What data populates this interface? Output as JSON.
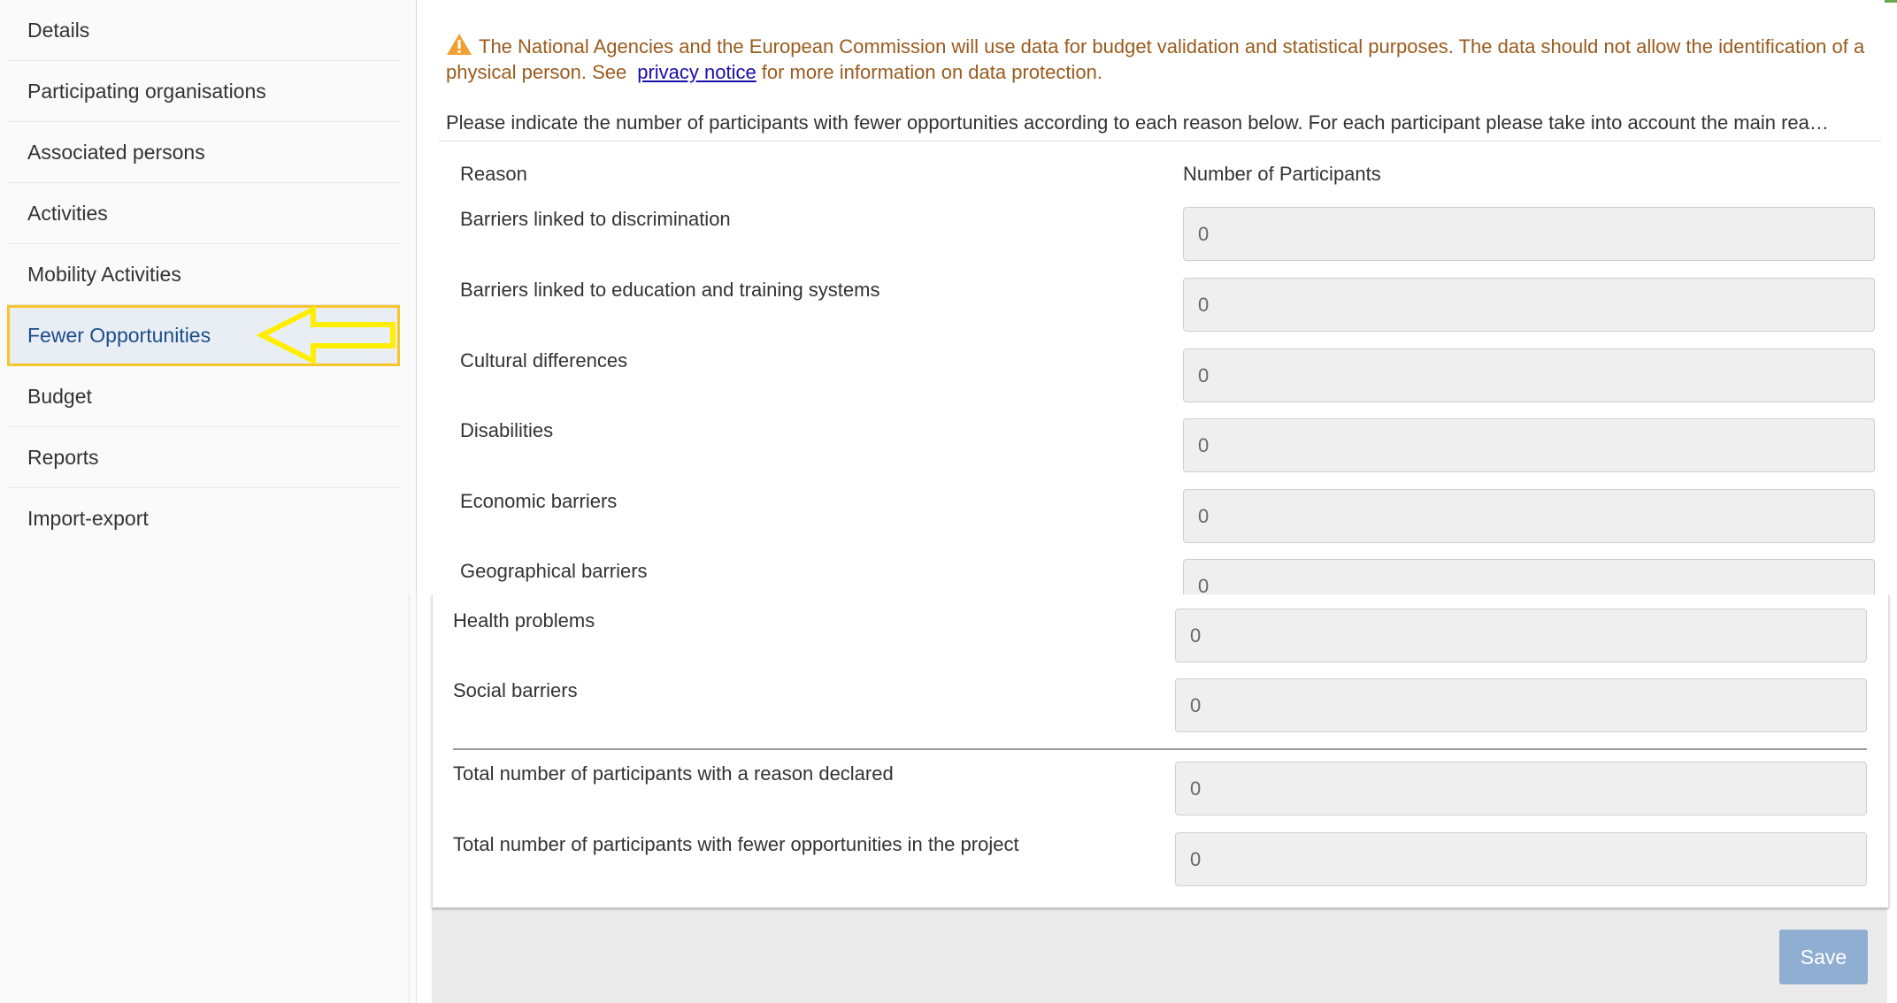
{
  "sidebar": {
    "items": [
      {
        "label": "Details"
      },
      {
        "label": "Participating organisations"
      },
      {
        "label": "Associated persons"
      },
      {
        "label": "Activities"
      },
      {
        "label": "Mobility Activities"
      },
      {
        "label": "Fewer Opportunities",
        "active": true
      },
      {
        "label": "Budget"
      },
      {
        "label": "Reports"
      },
      {
        "label": "Import-export"
      }
    ]
  },
  "notice": {
    "text_before": "The National Agencies and the European Commission will use data for budget validation and statistical purposes. The data should not allow the identification of a physical person. See",
    "link_text": "privacy notice",
    "text_after": "for more information on data protection.",
    "icon": "warning-icon"
  },
  "instruction": "Please indicate the number of participants with fewer opportunities according to each reason below. For each participant please take into account the main rea…",
  "table": {
    "col_reason": "Reason",
    "col_number": "Number of Participants",
    "rows": [
      {
        "reason": "Barriers linked to discrimination",
        "value": "0"
      },
      {
        "reason": "Barriers linked to education and training systems",
        "value": "0"
      },
      {
        "reason": "Cultural differences",
        "value": "0"
      },
      {
        "reason": "Disabilities",
        "value": "0"
      },
      {
        "reason": "Economic barriers",
        "value": "0"
      },
      {
        "reason": "Geographical barriers",
        "value": "0"
      },
      {
        "reason": "Health problems",
        "value": "0"
      },
      {
        "reason": "Social barriers",
        "value": "0"
      }
    ],
    "totals": [
      {
        "label": "Total number of participants with a reason declared",
        "value": "0"
      },
      {
        "label": "Total number of participants with fewer opportunities in the project",
        "value": "0"
      }
    ]
  },
  "save_label": "Save",
  "colors": {
    "active_nav_text": "#1d4e89",
    "highlight_border": "#f6c62c",
    "arrow": "#ffee00",
    "warning_text": "#9a5b1d",
    "warning_icon": "#f0a030",
    "link": "#1a0dab",
    "save_button": "#8faed1",
    "accent_bar": "#6aa84f"
  }
}
